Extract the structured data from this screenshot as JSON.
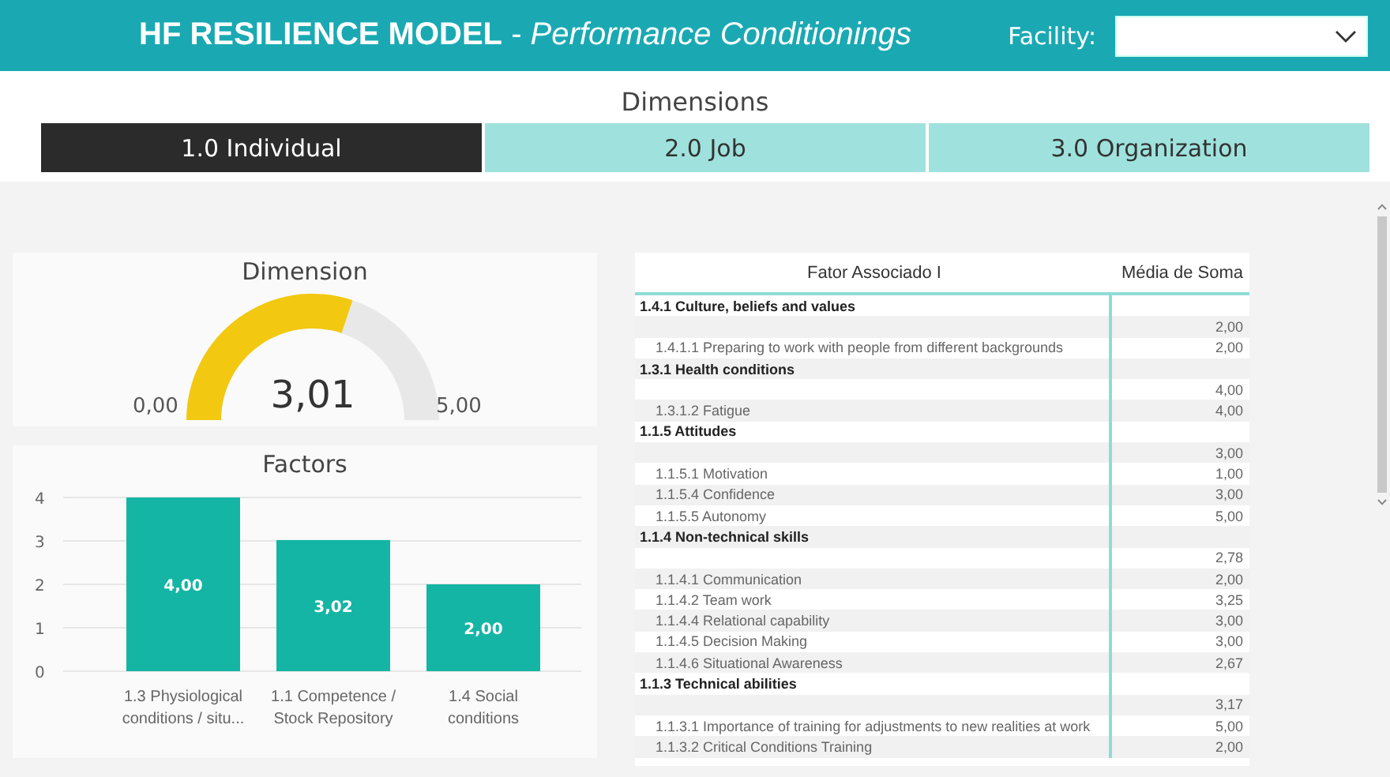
{
  "header": {
    "title": "HF RESILIENCE MODEL",
    "separator": "-",
    "subtitle": "Performance Conditionings",
    "facility_label": "Facility:"
  },
  "dimensions": {
    "title": "Dimensions",
    "tabs": [
      {
        "label": "1.0 Individual",
        "selected": true
      },
      {
        "label": "2.0 Job",
        "selected": false
      },
      {
        "label": "3.0 Organization",
        "selected": false
      }
    ]
  },
  "gauge": {
    "title": "Dimension",
    "value": "3,01",
    "min": "0,00",
    "max": "5,00"
  },
  "factors": {
    "title": "Factors",
    "chart_data": {
      "type": "bar",
      "categories": [
        "1.3 Physiological conditions / situ...",
        "1.1 Competence / Stock Repository",
        "1.4 Social conditions"
      ],
      "values": [
        4.0,
        3.02,
        2.0
      ],
      "grid": true,
      "value_labels": [
        "4,00",
        "3,02",
        "2,00"
      ],
      "yticks": [
        0,
        1,
        2,
        3,
        4
      ],
      "ylim": [
        0,
        4
      ]
    }
  },
  "table": {
    "columns": [
      "Fator Associado I",
      "Média de Soma"
    ],
    "rows": [
      {
        "kind": "group",
        "label": "1.4.1 Culture, beliefs and values",
        "value": ""
      },
      {
        "kind": "subtotal",
        "label": "",
        "value": "2,00"
      },
      {
        "kind": "item",
        "label": "1.4.1.1 Preparing to work with people from different backgrounds",
        "value": "2,00"
      },
      {
        "kind": "group",
        "label": "1.3.1 Health conditions",
        "value": ""
      },
      {
        "kind": "subtotal",
        "label": "",
        "value": "4,00"
      },
      {
        "kind": "item",
        "label": "1.3.1.2 Fatigue",
        "value": "4,00"
      },
      {
        "kind": "group",
        "label": "1.1.5 Attitudes",
        "value": ""
      },
      {
        "kind": "subtotal",
        "label": "",
        "value": "3,00"
      },
      {
        "kind": "item",
        "label": "1.1.5.1 Motivation",
        "value": "1,00"
      },
      {
        "kind": "item",
        "label": "1.1.5.4 Confidence",
        "value": "3,00"
      },
      {
        "kind": "item",
        "label": "1.1.5.5 Autonomy",
        "value": "5,00"
      },
      {
        "kind": "group",
        "label": "1.1.4 Non-technical skills",
        "value": ""
      },
      {
        "kind": "subtotal",
        "label": "",
        "value": "2,78"
      },
      {
        "kind": "item",
        "label": "1.1.4.1 Communication",
        "value": "2,00"
      },
      {
        "kind": "item",
        "label": "1.1.4.2 Team work",
        "value": "3,25"
      },
      {
        "kind": "item",
        "label": "1.1.4.4 Relational capability",
        "value": "3,00"
      },
      {
        "kind": "item",
        "label": "1.1.4.5 Decision Making",
        "value": "3,00"
      },
      {
        "kind": "item",
        "label": "1.1.4.6 Situational Awareness",
        "value": "2,67"
      },
      {
        "kind": "group",
        "label": "1.1.3 Technical abilities",
        "value": ""
      },
      {
        "kind": "subtotal",
        "label": "",
        "value": "3,17"
      },
      {
        "kind": "item",
        "label": "1.1.3.1 Importance of training for adjustments to new realities at work",
        "value": "5,00"
      },
      {
        "kind": "item",
        "label": "1.1.3.2 Critical Conditions Training",
        "value": "2,00"
      }
    ]
  }
}
